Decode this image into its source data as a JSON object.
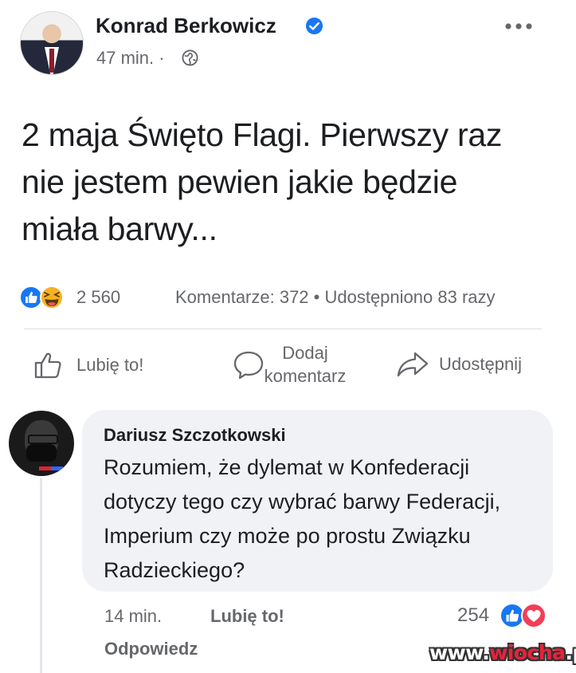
{
  "post": {
    "author": "Konrad Berkowicz",
    "time": "47 min.",
    "separator": "·",
    "text": "2 maja Święto Flagi. Pierwszy raz nie jestem pewien jakie będzie miała barwy...",
    "reaction_count": "2 560",
    "stats": "Komentarze: 372 • Udostępniono 83 razy",
    "icons": {
      "verified": "verified-badge-icon",
      "privacy": "globe-icon",
      "more": "more-options-icon",
      "reactions": [
        "like-reaction-icon",
        "haha-reaction-icon"
      ]
    }
  },
  "actions": {
    "like": "Lubię to!",
    "comment": "Dodaj komentarz",
    "share": "Udostępnij"
  },
  "comment": {
    "author": "Dariusz Szczotkowski",
    "text": "Rozumiem, że dylemat w Konfederacji dotyczy tego czy wybrać barwy Federacji, Imperium czy może po prostu Związku Radzieckiego?",
    "time": "14 min.",
    "like": "Lubię to!",
    "reply": "Odpowiedz",
    "reaction_count": "254",
    "reactions": [
      "like-reaction-icon",
      "love-reaction-icon"
    ]
  },
  "watermark": {
    "prefix": "www.",
    "name": "wiocha",
    "suffix": ".pl"
  },
  "colors": {
    "facebook_blue": "#1877f2",
    "secondary_text": "#65676b",
    "bubble": "#f0f2f5",
    "haha_yellow": "#f7b125",
    "love_red": "#f33e58"
  }
}
